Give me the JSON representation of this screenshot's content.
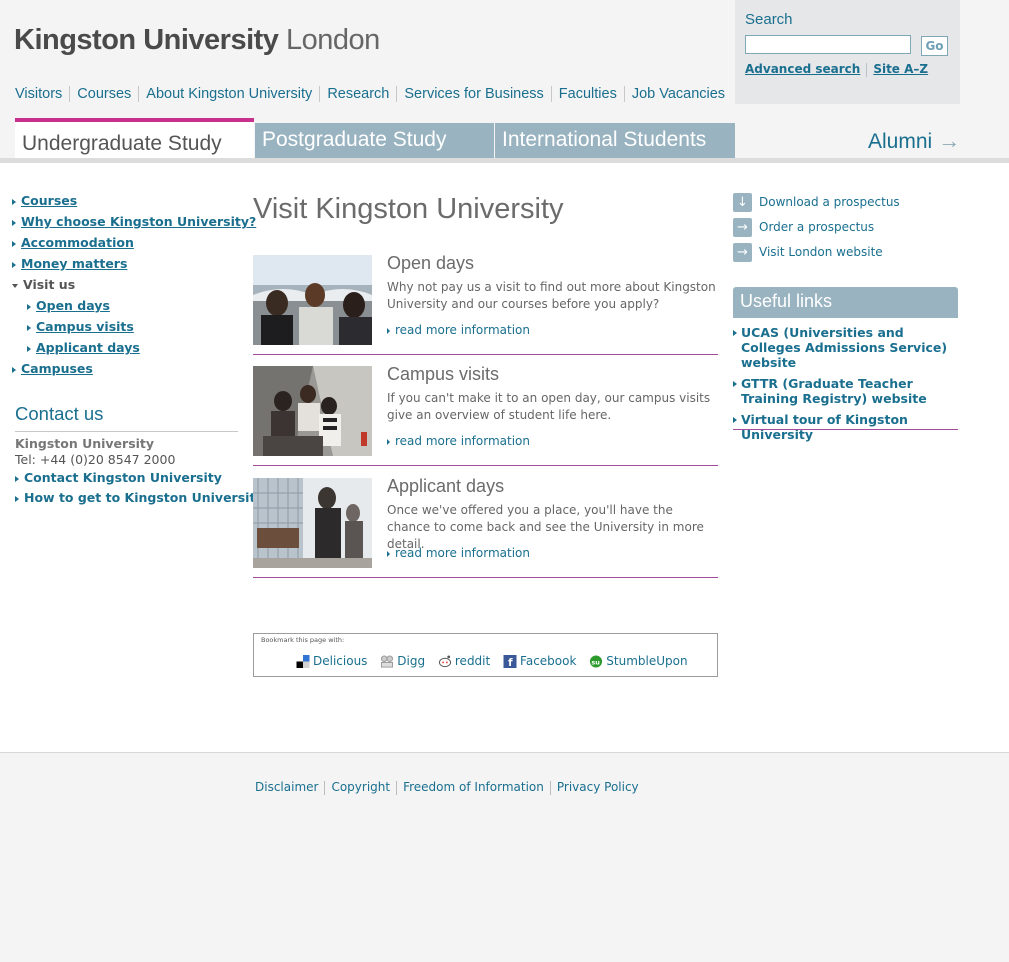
{
  "header": {
    "logo_bold": "Kingston University",
    "logo_light": " London"
  },
  "topnav": [
    "Visitors",
    "Courses",
    "About Kingston University",
    "Research",
    "Services for Business",
    "Faculties",
    "Job Vacancies"
  ],
  "search": {
    "label": "Search",
    "value": "",
    "go_label": "Go",
    "advanced": "Advanced search",
    "az": "Site A–Z"
  },
  "tabs": {
    "undergraduate": "Undergraduate Study",
    "postgraduate": "Postgraduate Study",
    "international": "International Students",
    "alumni": "Alumni",
    "alumni_arrow": "→"
  },
  "colors": {
    "undergraduate_accent": "#c7318c",
    "postgraduate_accent": "#20b79a",
    "international_accent": "#f2c500",
    "tab_grey": "#99b3c0",
    "link": "#1a6f8f"
  },
  "leftnav": {
    "courses": "Courses",
    "why": "Why choose Kingston University?",
    "accommodation": "Accommodation",
    "money": "Money matters",
    "visit_us": "Visit us",
    "open_days": "Open days",
    "campus_visits": "Campus visits",
    "applicant_days": "Applicant days",
    "campuses": "Campuses"
  },
  "contact": {
    "heading": "Contact us",
    "org": "Kingston University",
    "tel": "Tel: +44 (0)20 8547 2000",
    "contact_link": "Contact Kingston University",
    "directions_link": "How to get to Kingston University"
  },
  "main": {
    "title": "Visit Kingston University",
    "blocks": [
      {
        "title": "Open days",
        "desc": "Why not pay us a visit to find out more about Kingston University and our courses before you apply?",
        "more": "read more information"
      },
      {
        "title": "Campus visits",
        "desc": "If you can't make it to an open day, our campus visits give an overview of student life here.",
        "more": "read more information"
      },
      {
        "title": "Applicant days",
        "desc": "Once we've offered you a place, you'll have the chance to come back and see the University in more detail.",
        "more": "read more information"
      }
    ]
  },
  "bookmark": {
    "label": "Bookmark this page with:",
    "delicious": "Delicious",
    "digg": "Digg",
    "reddit": "reddit",
    "facebook": "Facebook",
    "stumbleupon": "StumbleUpon"
  },
  "right": {
    "download": "Download a prospectus",
    "download_icon": "↓",
    "order": "Order a prospectus",
    "order_icon": "→",
    "visit_london": "Visit London website",
    "visit_london_icon": "→",
    "useful_heading": "Useful links",
    "useful": [
      "UCAS (Universities and Colleges Admissions Service) website",
      "GTTR (Graduate Teacher Training Registry) website",
      "Virtual tour of Kingston University"
    ]
  },
  "footer": [
    "Disclaimer",
    "Copyright",
    "Freedom of Information",
    "Privacy Policy"
  ]
}
